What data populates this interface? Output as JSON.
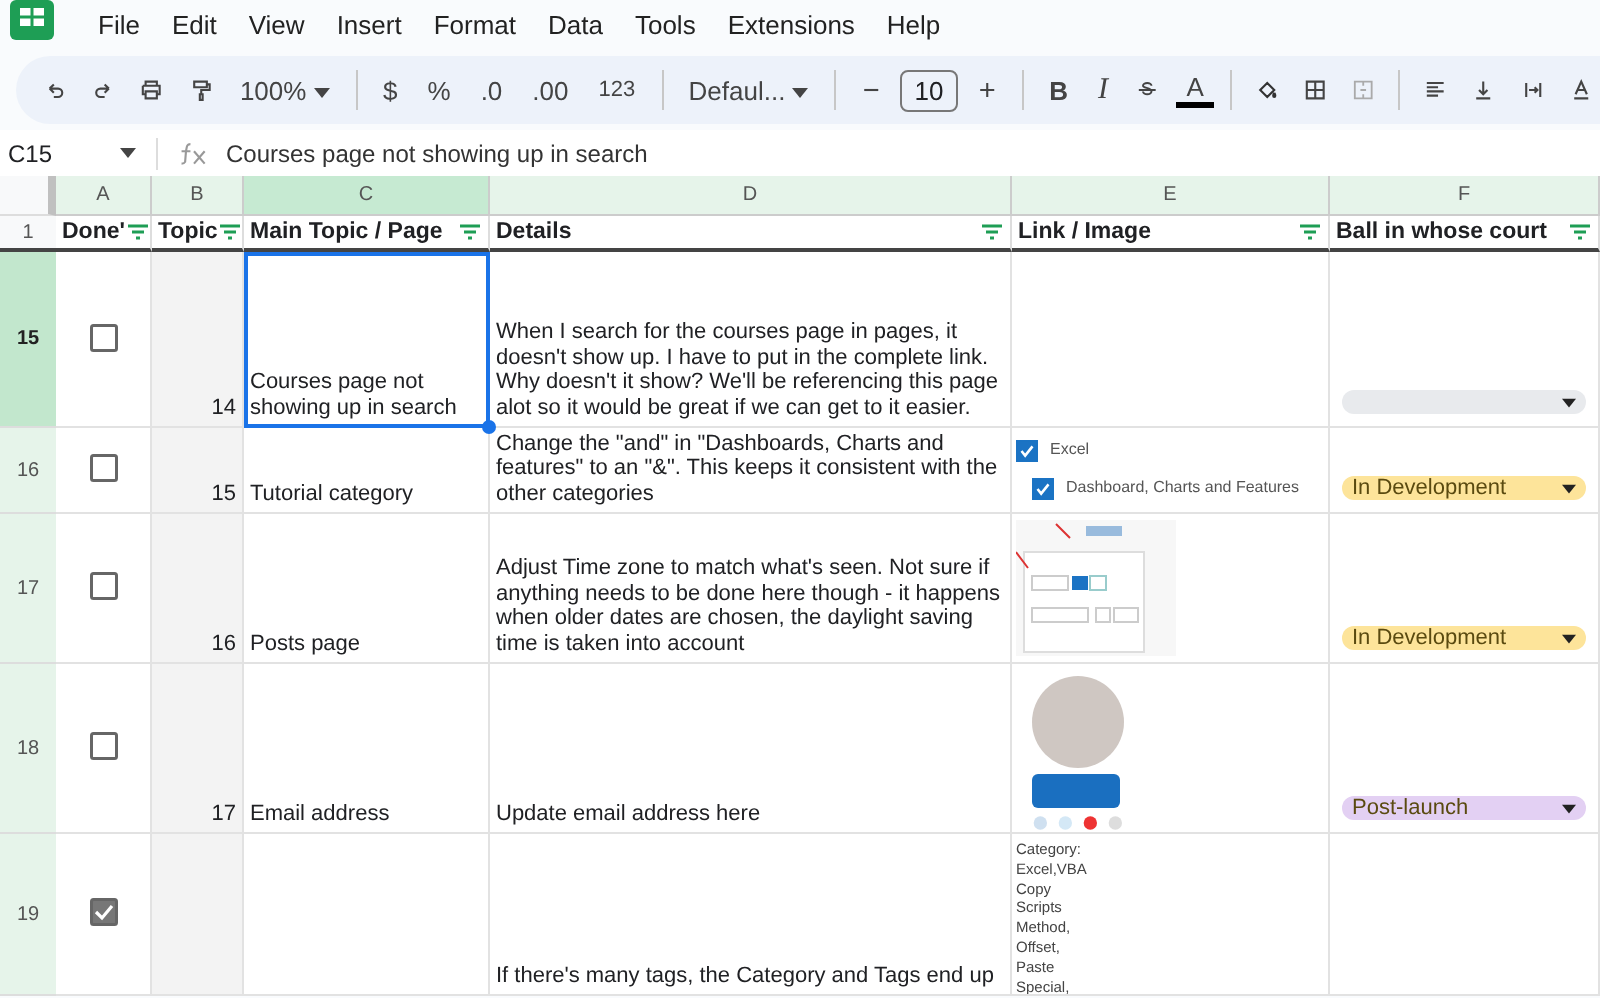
{
  "menu": [
    "File",
    "Edit",
    "View",
    "Insert",
    "Format",
    "Data",
    "Tools",
    "Extensions",
    "Help"
  ],
  "toolbar": {
    "zoom": "100%",
    "currency": "$",
    "percent": "%",
    "decrease_decimals": ".0",
    "increase_decimals": ".00",
    "number_format": "123",
    "font": "Defaul...",
    "font_size": "10",
    "bold": "B",
    "italic": "I",
    "text_color": "A"
  },
  "formula_bar": {
    "cell_ref": "C15",
    "content": "Courses page not showing up in search"
  },
  "columns": [
    {
      "letter": "A",
      "selected": false
    },
    {
      "letter": "B",
      "selected": false
    },
    {
      "letter": "C",
      "selected": true
    },
    {
      "letter": "D",
      "selected": false
    },
    {
      "letter": "E",
      "selected": false
    },
    {
      "letter": "F",
      "selected": false
    }
  ],
  "header_row": {
    "number": "1",
    "cells": [
      "Done'",
      "Topic",
      "Main Topic / Page",
      "Details",
      "Link / Image",
      "Ball in whose court"
    ]
  },
  "rows": [
    {
      "number": "15",
      "selected": true,
      "done": false,
      "topic_no": "14",
      "topic": "Courses page not showing up in search",
      "details": "When I search for the courses page in pages, it doesn't show up. I have to put in the complete link. Why doesn't it show? We'll be referencing this page alot so it would be great if we can get to it easier.",
      "link": {
        "kind": "blank"
      },
      "status": {
        "color": "#e8eaed"
      }
    },
    {
      "number": "16",
      "selected": false,
      "done": false,
      "topic_no": "15",
      "topic": "Tutorial category",
      "details": "Change the \"and\" in \"Dashboards, Charts and features\" to an \"&\". This keeps it consistent with the other categories",
      "link": {
        "kind": "checklist",
        "items": [
          {
            "label": "Excel",
            "checked": true,
            "children": [
              {
                "label": "Dashboard, Charts and Features",
                "checked": true
              }
            ]
          }
        ]
      },
      "status": {
        "label": "In Development",
        "color": "#fde49a"
      }
    },
    {
      "number": "17",
      "selected": false,
      "done": false,
      "topic_no": "16",
      "topic": "Posts page",
      "details": "Adjust Time zone to match what's seen. Not sure if anything needs to be done here though - it happens when older dates are chosen, the daylight saving time is taken into account",
      "link": {
        "kind": "screenshot"
      },
      "status": {
        "label": "In Development",
        "color": "#fde49a"
      }
    },
    {
      "number": "18",
      "selected": false,
      "done": false,
      "topic_no": "17",
      "topic": "Email address",
      "details": "Update email address here",
      "link": {
        "kind": "profile"
      },
      "status": {
        "label": "Post-launch",
        "color": "#e3d0f3"
      }
    },
    {
      "number": "19",
      "selected": false,
      "done": true,
      "details": "If there's many tags, the Category and Tags end up",
      "link": {
        "kind": "text_list",
        "lines": [
          "Category:",
          "Excel,VBA",
          "Copy",
          "Scripts",
          "Method,",
          "Offset,",
          "Paste",
          "Special,"
        ]
      }
    }
  ]
}
